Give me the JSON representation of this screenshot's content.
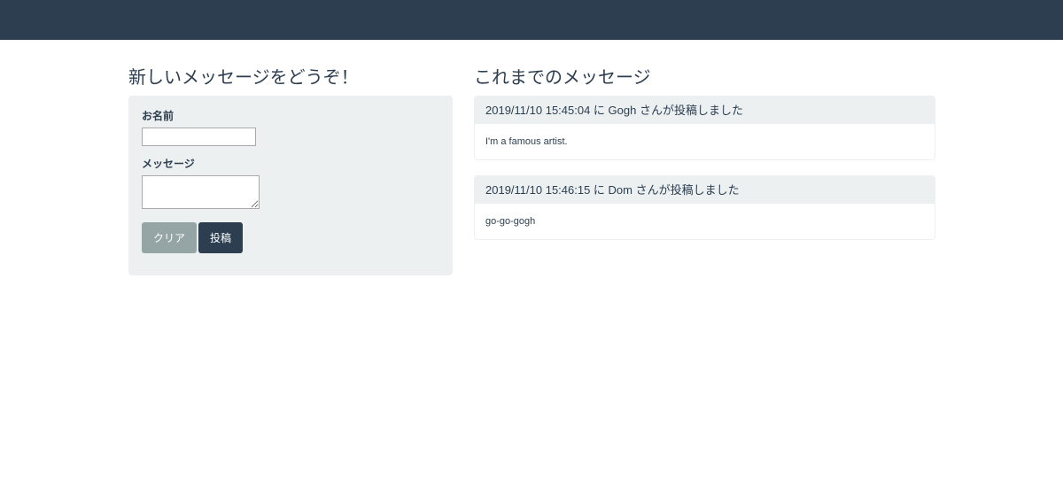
{
  "form": {
    "title": "新しいメッセージをどうぞ！",
    "name_label": "お名前",
    "name_value": "",
    "message_label": "メッセージ",
    "message_value": "",
    "clear_button": "クリア",
    "post_button": "投稿"
  },
  "messages": {
    "title": "これまでのメッセージ",
    "items": [
      {
        "header": "2019/11/10 15:45:04 に Gogh さんが投稿しました",
        "body": "I'm a famous artist."
      },
      {
        "header": "2019/11/10 15:46:15 に Dom さんが投稿しました",
        "body": "go-go-gogh"
      }
    ]
  },
  "colors": {
    "navbar": "#2c3e50",
    "well": "#ecf0f1",
    "clear_button": "#95a5a6",
    "post_button": "#2c3e50"
  }
}
